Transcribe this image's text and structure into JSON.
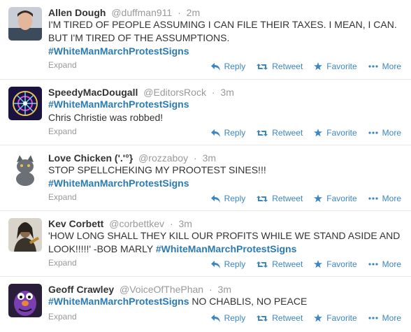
{
  "actions": {
    "reply": "Reply",
    "retweet": "Retweet",
    "favorite": "Favorite",
    "more": "More",
    "expand": "Expand"
  },
  "colors": {
    "link": "#2a7ab6",
    "action": "#3b86c4",
    "muted": "#999999"
  },
  "tweets": [
    {
      "name": "Allen Dough",
      "handle": "@duffman911",
      "time": "2m",
      "text_lines": [
        "I'M TIRED OF PEOPLE ASSUMING I CAN FILE THEIR TAXES. I MEAN, I CAN.",
        "BUT I'M TIRED OF THE ASSUMPTIONS."
      ],
      "hashtag": "#WhiteManMarchProtestSigns",
      "avatar_icon": "person-photo"
    },
    {
      "name": "SpeedyMacDougall",
      "handle": "@EditorsRock",
      "time": "3m",
      "hashtag": "#WhiteManMarchProtestSigns",
      "text": "Chris Christie was robbed!",
      "avatar_icon": "ferris-wheel-photo"
    },
    {
      "name": "Love Chicken ('.'°}",
      "handle": "@rozzaboy",
      "time": "3m",
      "text": "STOP SPELLCHEKING MY PROOTEST SINES!!!",
      "hashtag": "#WhiteManMarchProtestSigns",
      "avatar_icon": "kitten-photo"
    },
    {
      "name": "Kev Corbett",
      "handle": "@corbettkev",
      "time": "3m",
      "text_line1": "'HOW LONG SHALL THEY KILL OUR PROFITS WHILE WE STAND ASIDE AND",
      "text_line2_prefix": "LOOK!!!!!' -BOB MARLY ",
      "hashtag": "#WhiteManMarchProtestSigns",
      "avatar_icon": "musician-photo"
    },
    {
      "name": "Geoff Crawley",
      "handle": "@VoiceOfThePhan",
      "time": "3m",
      "hashtag": "#WhiteManMarchProtestSigns",
      "text_suffix": " NO CHABLIS, NO PEACE",
      "avatar_icon": "purple-puppet-photo"
    }
  ]
}
